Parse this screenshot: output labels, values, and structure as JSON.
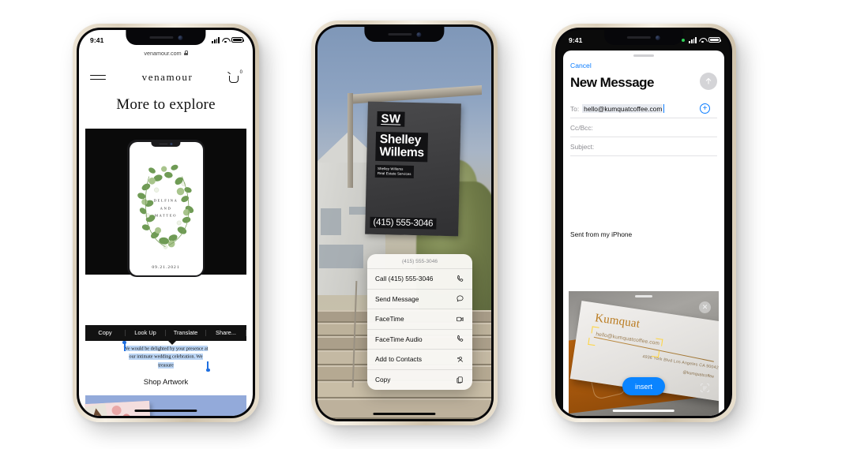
{
  "phone1": {
    "name": "safari-venamour",
    "status": {
      "time": "9:41"
    },
    "url": "venamour.com",
    "brand": "venamour",
    "cart_badge": "0",
    "heading": "More to explore",
    "invite": {
      "line1": "DELFINA",
      "line2": "AND",
      "line3": "MATTEO",
      "date": "09.21.2021"
    },
    "action_bar": [
      "Copy",
      "Look Up",
      "Translate",
      "Share..."
    ],
    "selected_text": "We would be delighted by your presence at our intimate wedding celebration. We treasure",
    "shop_link": "Shop Artwork"
  },
  "phone2": {
    "name": "camera-live-text",
    "sign": {
      "monogram": "SW",
      "name_line1": "Shelley",
      "name_line2": "Willems",
      "sub_line1": "Shelley Willems",
      "sub_line2": "Real Estate Services",
      "phone": "(415) 555-3046"
    },
    "context_menu": {
      "title": "(415) 555-3046",
      "items": [
        {
          "label": "Call (415) 555-3046",
          "icon": "phone-icon"
        },
        {
          "label": "Send Message",
          "icon": "message-bubble-icon"
        },
        {
          "label": "FaceTime",
          "icon": "video-camera-icon"
        },
        {
          "label": "FaceTime Audio",
          "icon": "phone-icon"
        },
        {
          "label": "Add to Contacts",
          "icon": "add-contact-icon"
        },
        {
          "label": "Copy",
          "icon": "copy-icon"
        }
      ]
    }
  },
  "phone3": {
    "name": "mail-compose-scan-text",
    "status": {
      "time": "9:41"
    },
    "cancel": "Cancel",
    "title": "New Message",
    "fields": [
      {
        "label": "To:",
        "value": "hello@kumquatcoffee.com"
      },
      {
        "label": "Cc/Bcc:",
        "value": ""
      },
      {
        "label": "Subject:",
        "value": ""
      }
    ],
    "body": "Sent from my iPhone",
    "business_card": {
      "brand": "Kumquat",
      "email": "hello@kumquatcoffee.com",
      "address": "4936 York Blvd Los Angeles CA 90042",
      "handle": "@kumquatcoffee"
    },
    "insert_button": "insert",
    "colors": {
      "accent": "#0a84ff",
      "link": "#0a7cff",
      "highlight": "#ffd43b"
    }
  }
}
